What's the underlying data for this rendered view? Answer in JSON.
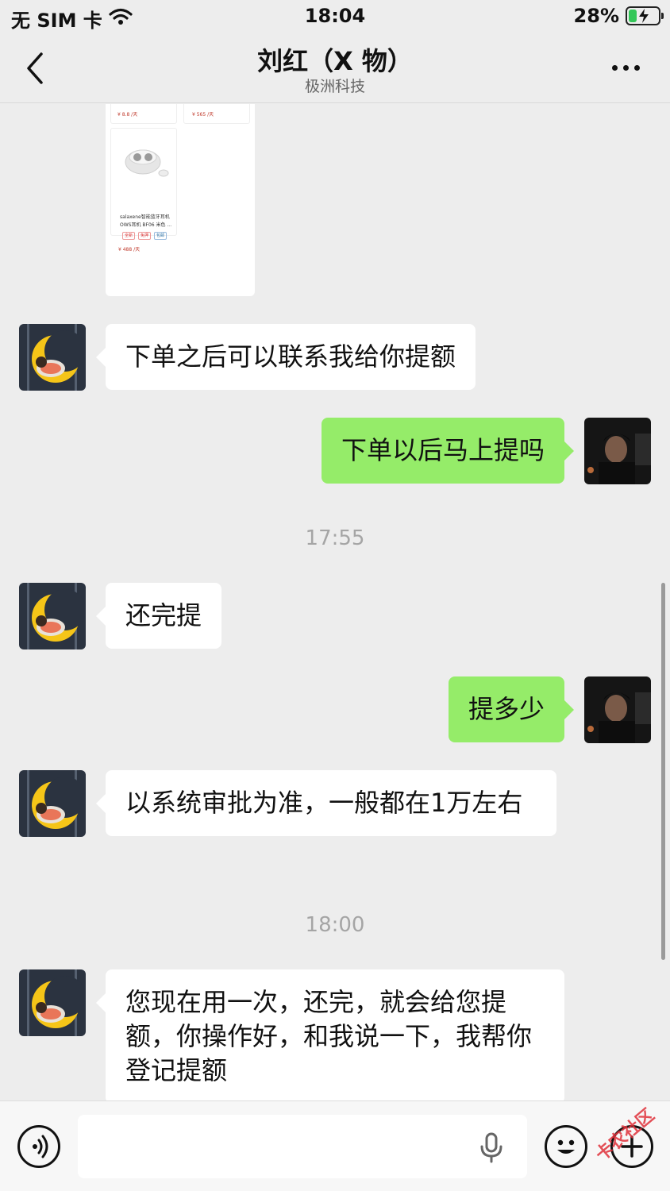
{
  "status_bar": {
    "carrier": "无 SIM 卡",
    "time": "18:04",
    "battery": "28%",
    "battery_level": 0.28,
    "icons": [
      "wifi-icon",
      "battery-charging-icon"
    ]
  },
  "nav": {
    "title": "刘红（X 物）",
    "subtitle": "极洲科技",
    "icons": [
      "back-chevron-icon",
      "more-dots-icon"
    ]
  },
  "product_card": {
    "price_1": "¥ 8.8 /天",
    "price_2": "¥ 565 /天",
    "product_name": "salaxene智能蓝牙耳机 OWS耳机 BF06 米色 ...",
    "tags": [
      "全新",
      "免押",
      "包邮"
    ],
    "price_3": "¥ 488 /天"
  },
  "messages": [
    {
      "side": "in",
      "text": "下单之后可以联系我给你提额"
    },
    {
      "side": "out",
      "text": "下单以后马上提吗"
    },
    {
      "side": "in",
      "text": "还完提"
    },
    {
      "side": "out",
      "text": "提多少"
    },
    {
      "side": "in",
      "text": "以系统审批为准，一般都在1万左右"
    },
    {
      "side": "in",
      "text": "您现在用一次，还完，就会给您提额，你操作好，和我说一下，我帮你登记提额"
    }
  ],
  "timestamps": [
    "17:55",
    "18:00"
  ],
  "input_bar": {
    "value": "",
    "icons": [
      "voice-icon",
      "microphone-icon",
      "emoji-icon",
      "plus-icon"
    ]
  },
  "watermark": "卡农社区",
  "colors": {
    "background": "#ededed",
    "outgoing_bubble": "#95ec69",
    "incoming_bubble": "#ffffff",
    "timestamp": "#a5a5a5",
    "battery_green": "#34c759"
  }
}
